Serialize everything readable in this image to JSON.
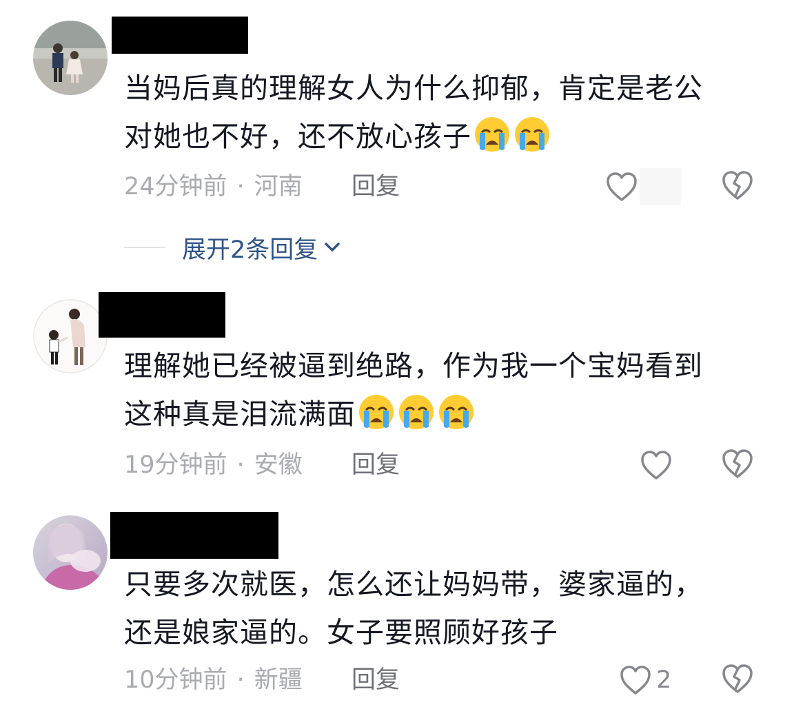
{
  "comments": [
    {
      "text_line1": "当妈后真的理解女人为什么抑郁，肯定是老公",
      "text_line2": "对她也不好，还不放心孩子",
      "emoji": [
        "loudly-crying-emoji",
        "loudly-crying-emoji"
      ],
      "time": "24分钟前",
      "separator": "·",
      "location": "河南",
      "reply_label": "回复",
      "like_count": "",
      "expand_label": "展开2条回复"
    },
    {
      "text_line1": "理解她已经被逼到绝路，作为我一个宝妈看到",
      "text_line2": "这种真是泪流满面",
      "emoji": [
        "loudly-crying-emoji",
        "loudly-crying-emoji",
        "loudly-crying-emoji"
      ],
      "time": "19分钟前",
      "separator": "·",
      "location": "安徽",
      "reply_label": "回复",
      "like_count": ""
    },
    {
      "text_line1": "只要多次就医，怎么还让妈妈带，婆家逼的，",
      "text_line2": "还是娘家逼的。女子要照顾好孩子",
      "emoji": [],
      "time": "10分钟前",
      "separator": "·",
      "location": "新疆",
      "reply_label": "回复",
      "like_count": "2"
    }
  ],
  "icons": {
    "like": "heart-outline-icon",
    "dislike": "broken-heart-icon",
    "expand": "chevron-down-icon"
  },
  "colors": {
    "text": "#161823",
    "meta": "#a9abb0",
    "reply": "#6f7178",
    "expand_link": "#2e5587",
    "redaction": "#000000"
  }
}
